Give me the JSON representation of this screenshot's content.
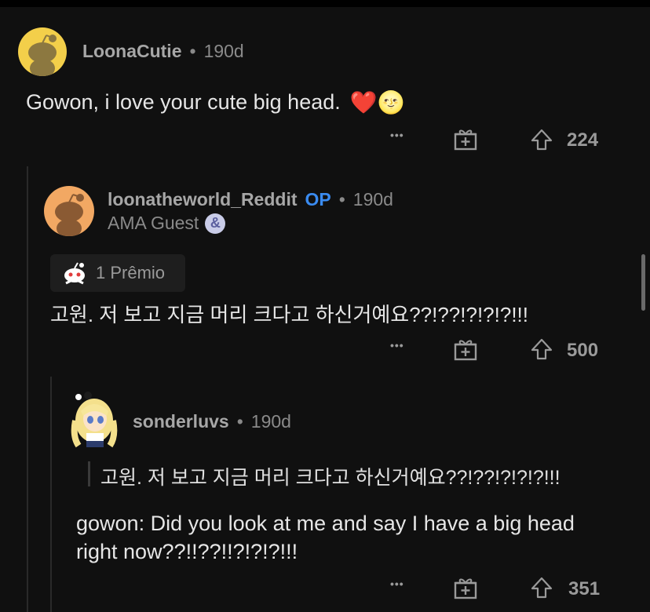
{
  "comments": [
    {
      "username": "LoonaCutie",
      "age": "190d",
      "body": "Gowon, i love your cute big head.",
      "emoji": "❤️🌝",
      "more": "•••",
      "upvotes": "224"
    },
    {
      "username": "loonatheworld_Reddit",
      "op_badge": "OP",
      "age": "190d",
      "flair": "AMA Guest",
      "flair_icon": "&",
      "award": "1 Prêmio",
      "body": "고원. 저 보고 지금 머리 크다고 하신거예요??!??!?!?!?!!!",
      "more": "•••",
      "upvotes": "500"
    },
    {
      "username": "sonderluvs",
      "age": "190d",
      "quote": "고원. 저 보고 지금 머리 크다고 하신거예요??!??!?!?!?!!!",
      "body": "gowon: Did you look at me and say I have a big head right now??!!??!!?!?!?!!!",
      "more": "•••",
      "upvotes": "351"
    }
  ],
  "separator": "•",
  "colors": {
    "background": "#101010",
    "op": "#3a8bf0",
    "muted": "#8a8a8a",
    "avatar_yellow": "#f3cf4a",
    "avatar_orange": "#f2a863"
  }
}
